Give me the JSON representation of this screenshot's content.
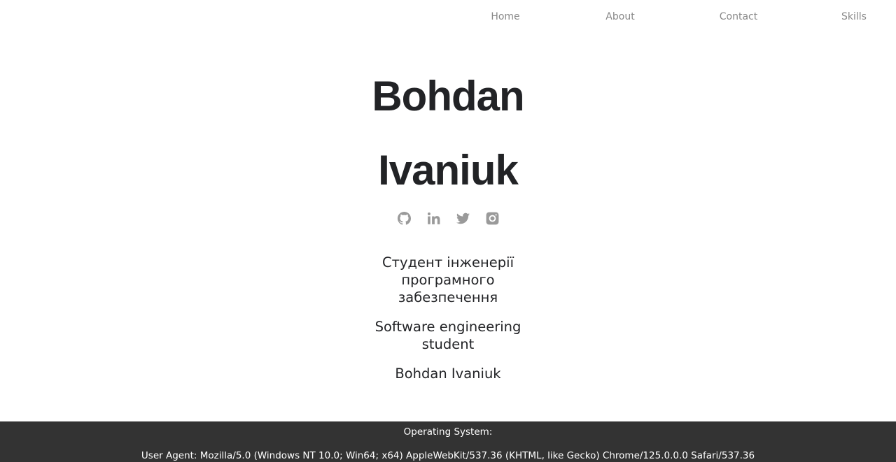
{
  "nav": {
    "items": [
      {
        "label": "Home"
      },
      {
        "label": "About"
      },
      {
        "label": "Contact"
      },
      {
        "label": "Skills"
      }
    ]
  },
  "hero": {
    "first_name": "Bohdan",
    "last_name": "Ivaniuk"
  },
  "socials": [
    {
      "icon": "github-icon"
    },
    {
      "icon": "linkedin-icon"
    },
    {
      "icon": "twitter-icon"
    },
    {
      "icon": "instagram-icon"
    }
  ],
  "description": {
    "ukrainian": "Студент інженерії програмного забезпечення",
    "english": "Software engineering student",
    "name": "Bohdan Ivaniuk"
  },
  "footer": {
    "os_label": "Operating System:",
    "user_agent": "User Agent: Mozilla/5.0 (Windows NT 10.0; Win64; x64) AppleWebKit/537.36 (KHTML, like Gecko) Chrome/125.0.0.0 Safari/537.36"
  },
  "colors": {
    "text": "#222326",
    "nav_text": "#888888",
    "icon": "#9a9a9a",
    "footer_bg": "#333333",
    "footer_text": "#ffffff"
  }
}
